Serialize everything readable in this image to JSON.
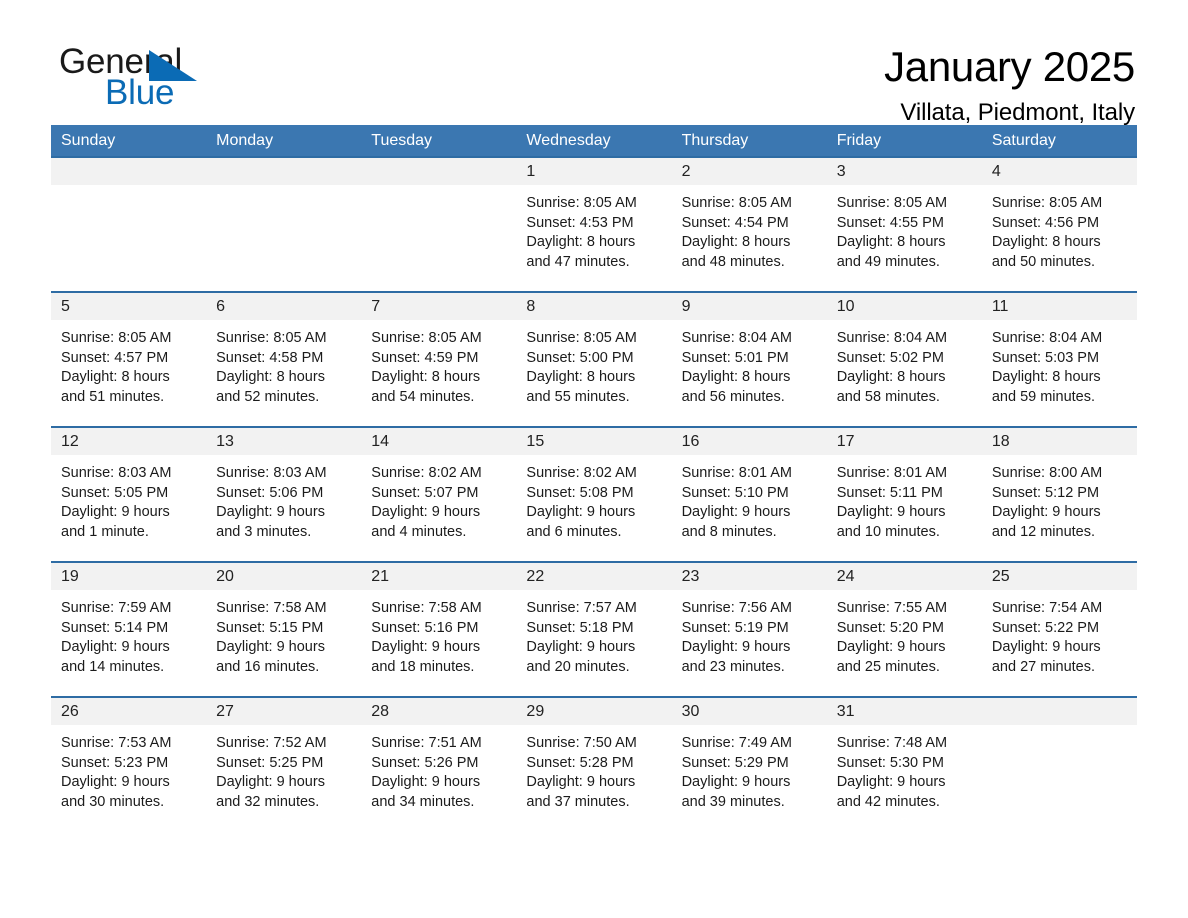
{
  "brand": {
    "name_part1": "General",
    "name_part2": "Blue",
    "flag_icon": "triangle-flag-icon",
    "accent_color": "#0b6bb5"
  },
  "header": {
    "title": "January 2025",
    "subtitle": "Villata, Piedmont, Italy"
  },
  "colors": {
    "header_row_bg": "#3b77b1",
    "header_row_text": "#ffffff",
    "day_number_bg": "#f2f2f2",
    "cell_border_top": "#2e6ca4",
    "page_bg": "#ffffff"
  },
  "weekdays": [
    "Sunday",
    "Monday",
    "Tuesday",
    "Wednesday",
    "Thursday",
    "Friday",
    "Saturday"
  ],
  "labels": {
    "sunrise_prefix": "Sunrise:",
    "sunset_prefix": "Sunset:",
    "daylight_prefix": "Daylight:"
  },
  "weeks": [
    [
      {
        "day": "",
        "lines": []
      },
      {
        "day": "",
        "lines": []
      },
      {
        "day": "",
        "lines": []
      },
      {
        "day": "1",
        "lines": [
          "Sunrise: 8:05 AM",
          "Sunset: 4:53 PM",
          "Daylight: 8 hours",
          "and 47 minutes."
        ]
      },
      {
        "day": "2",
        "lines": [
          "Sunrise: 8:05 AM",
          "Sunset: 4:54 PM",
          "Daylight: 8 hours",
          "and 48 minutes."
        ]
      },
      {
        "day": "3",
        "lines": [
          "Sunrise: 8:05 AM",
          "Sunset: 4:55 PM",
          "Daylight: 8 hours",
          "and 49 minutes."
        ]
      },
      {
        "day": "4",
        "lines": [
          "Sunrise: 8:05 AM",
          "Sunset: 4:56 PM",
          "Daylight: 8 hours",
          "and 50 minutes."
        ]
      }
    ],
    [
      {
        "day": "5",
        "lines": [
          "Sunrise: 8:05 AM",
          "Sunset: 4:57 PM",
          "Daylight: 8 hours",
          "and 51 minutes."
        ]
      },
      {
        "day": "6",
        "lines": [
          "Sunrise: 8:05 AM",
          "Sunset: 4:58 PM",
          "Daylight: 8 hours",
          "and 52 minutes."
        ]
      },
      {
        "day": "7",
        "lines": [
          "Sunrise: 8:05 AM",
          "Sunset: 4:59 PM",
          "Daylight: 8 hours",
          "and 54 minutes."
        ]
      },
      {
        "day": "8",
        "lines": [
          "Sunrise: 8:05 AM",
          "Sunset: 5:00 PM",
          "Daylight: 8 hours",
          "and 55 minutes."
        ]
      },
      {
        "day": "9",
        "lines": [
          "Sunrise: 8:04 AM",
          "Sunset: 5:01 PM",
          "Daylight: 8 hours",
          "and 56 minutes."
        ]
      },
      {
        "day": "10",
        "lines": [
          "Sunrise: 8:04 AM",
          "Sunset: 5:02 PM",
          "Daylight: 8 hours",
          "and 58 minutes."
        ]
      },
      {
        "day": "11",
        "lines": [
          "Sunrise: 8:04 AM",
          "Sunset: 5:03 PM",
          "Daylight: 8 hours",
          "and 59 minutes."
        ]
      }
    ],
    [
      {
        "day": "12",
        "lines": [
          "Sunrise: 8:03 AM",
          "Sunset: 5:05 PM",
          "Daylight: 9 hours",
          "and 1 minute."
        ]
      },
      {
        "day": "13",
        "lines": [
          "Sunrise: 8:03 AM",
          "Sunset: 5:06 PM",
          "Daylight: 9 hours",
          "and 3 minutes."
        ]
      },
      {
        "day": "14",
        "lines": [
          "Sunrise: 8:02 AM",
          "Sunset: 5:07 PM",
          "Daylight: 9 hours",
          "and 4 minutes."
        ]
      },
      {
        "day": "15",
        "lines": [
          "Sunrise: 8:02 AM",
          "Sunset: 5:08 PM",
          "Daylight: 9 hours",
          "and 6 minutes."
        ]
      },
      {
        "day": "16",
        "lines": [
          "Sunrise: 8:01 AM",
          "Sunset: 5:10 PM",
          "Daylight: 9 hours",
          "and 8 minutes."
        ]
      },
      {
        "day": "17",
        "lines": [
          "Sunrise: 8:01 AM",
          "Sunset: 5:11 PM",
          "Daylight: 9 hours",
          "and 10 minutes."
        ]
      },
      {
        "day": "18",
        "lines": [
          "Sunrise: 8:00 AM",
          "Sunset: 5:12 PM",
          "Daylight: 9 hours",
          "and 12 minutes."
        ]
      }
    ],
    [
      {
        "day": "19",
        "lines": [
          "Sunrise: 7:59 AM",
          "Sunset: 5:14 PM",
          "Daylight: 9 hours",
          "and 14 minutes."
        ]
      },
      {
        "day": "20",
        "lines": [
          "Sunrise: 7:58 AM",
          "Sunset: 5:15 PM",
          "Daylight: 9 hours",
          "and 16 minutes."
        ]
      },
      {
        "day": "21",
        "lines": [
          "Sunrise: 7:58 AM",
          "Sunset: 5:16 PM",
          "Daylight: 9 hours",
          "and 18 minutes."
        ]
      },
      {
        "day": "22",
        "lines": [
          "Sunrise: 7:57 AM",
          "Sunset: 5:18 PM",
          "Daylight: 9 hours",
          "and 20 minutes."
        ]
      },
      {
        "day": "23",
        "lines": [
          "Sunrise: 7:56 AM",
          "Sunset: 5:19 PM",
          "Daylight: 9 hours",
          "and 23 minutes."
        ]
      },
      {
        "day": "24",
        "lines": [
          "Sunrise: 7:55 AM",
          "Sunset: 5:20 PM",
          "Daylight: 9 hours",
          "and 25 minutes."
        ]
      },
      {
        "day": "25",
        "lines": [
          "Sunrise: 7:54 AM",
          "Sunset: 5:22 PM",
          "Daylight: 9 hours",
          "and 27 minutes."
        ]
      }
    ],
    [
      {
        "day": "26",
        "lines": [
          "Sunrise: 7:53 AM",
          "Sunset: 5:23 PM",
          "Daylight: 9 hours",
          "and 30 minutes."
        ]
      },
      {
        "day": "27",
        "lines": [
          "Sunrise: 7:52 AM",
          "Sunset: 5:25 PM",
          "Daylight: 9 hours",
          "and 32 minutes."
        ]
      },
      {
        "day": "28",
        "lines": [
          "Sunrise: 7:51 AM",
          "Sunset: 5:26 PM",
          "Daylight: 9 hours",
          "and 34 minutes."
        ]
      },
      {
        "day": "29",
        "lines": [
          "Sunrise: 7:50 AM",
          "Sunset: 5:28 PM",
          "Daylight: 9 hours",
          "and 37 minutes."
        ]
      },
      {
        "day": "30",
        "lines": [
          "Sunrise: 7:49 AM",
          "Sunset: 5:29 PM",
          "Daylight: 9 hours",
          "and 39 minutes."
        ]
      },
      {
        "day": "31",
        "lines": [
          "Sunrise: 7:48 AM",
          "Sunset: 5:30 PM",
          "Daylight: 9 hours",
          "and 42 minutes."
        ]
      },
      {
        "day": "",
        "lines": []
      }
    ]
  ]
}
